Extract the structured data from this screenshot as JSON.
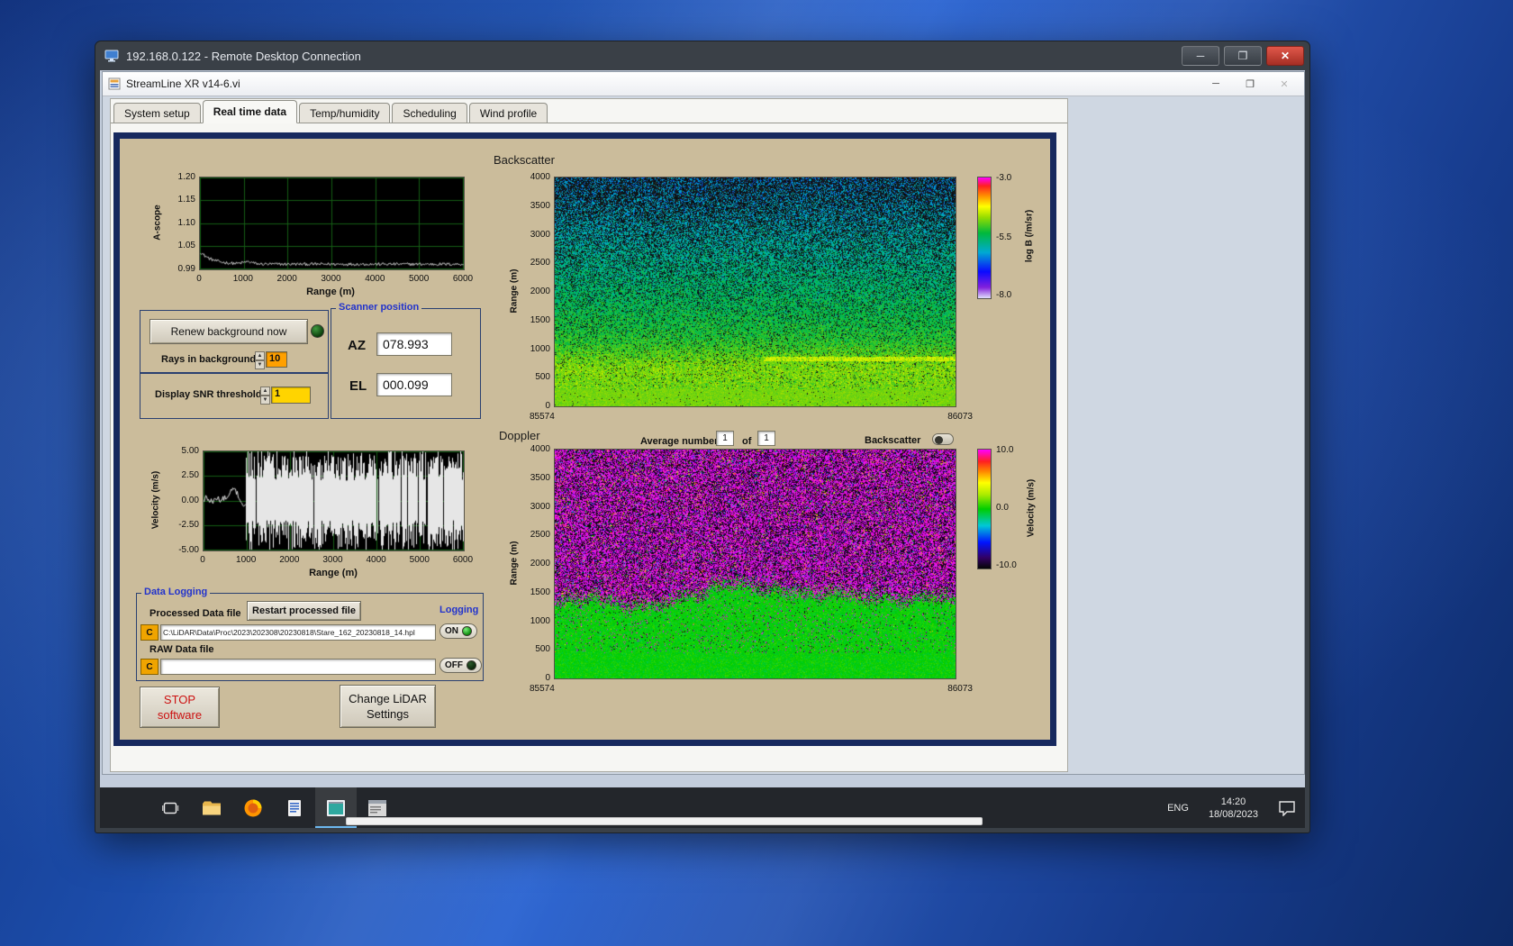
{
  "colors": {
    "panel_tan": "#cbbc9b",
    "panel_border_navy": "#17295e",
    "label_blue": "#2233cc",
    "stop_red": "#cc1111",
    "field_orange": "#ffa000",
    "field_yellow": "#ffd400",
    "led_green": "#2f8f2f",
    "taskbar_accent": "#6cb8f0"
  },
  "window_controls": {
    "minimize": "─",
    "maximize": "❐",
    "close": "✕"
  },
  "rdp": {
    "title": "192.168.0.122 - Remote Desktop Connection"
  },
  "app": {
    "title": "StreamLine XR v14-6.vi",
    "tabs": [
      "System setup",
      "Real time data",
      "Temp/humidity",
      "Scheduling",
      "Wind profile"
    ],
    "active_tab": "Real time data"
  },
  "background_controls": {
    "renew_button": "Renew background now",
    "rays_label": "Rays in background",
    "rays_value": "10",
    "snr_label": "Display SNR threshold",
    "snr_value": "1"
  },
  "scanner": {
    "title": "Scanner position",
    "az_label": "AZ",
    "az_value": "078.993",
    "el_label": "EL",
    "el_value": "000.099"
  },
  "doppler_bar": {
    "avg_label": "Average number",
    "avg_value": "1",
    "of_label": "of",
    "of_count": "1",
    "toggle_label": "Backscatter"
  },
  "logging": {
    "title": "Data Logging",
    "processed_label": "Processed Data file",
    "restart_button": "Restart processed file",
    "logging_label": "Logging",
    "drive": "C",
    "processed_path": "C:\\LiDAR\\Data\\Proc\\2023\\202308\\20230818\\Stare_162_20230818_14.hpl",
    "on_label": "ON",
    "raw_label": "RAW Data file",
    "raw_path": "",
    "off_label": "OFF"
  },
  "action_buttons": {
    "stop_line1": "STOP",
    "stop_line2": "software",
    "change_line1": "Change LiDAR",
    "change_line2": "Settings"
  },
  "taskbar": {
    "lang": "ENG",
    "time": "14:20",
    "date": "18/08/2023",
    "icons": [
      "task-view",
      "file-explorer",
      "firefox",
      "text-editor",
      "remote-viewer-active",
      "scan-schedules"
    ]
  },
  "chart_data": [
    {
      "id": "ascope",
      "type": "line",
      "title": "",
      "xlabel": "Range (m)",
      "ylabel": "A-scope",
      "xlim": [
        0,
        6000
      ],
      "ylim": [
        0.99,
        1.2
      ],
      "xtick_labels": [
        "0",
        "1000",
        "2000",
        "3000",
        "4000",
        "5000",
        "6000"
      ],
      "ytick_labels": [
        "1.20",
        "1.15",
        "1.10",
        "1.05",
        "0.99"
      ],
      "grid": true,
      "bg": "#000000",
      "grid_color": "#155c15",
      "trace_color": "#dcdcdc",
      "series": [
        {
          "name": "a-scope signal",
          "summary": "noisy flat trace near 1.00 with bump to ~1.03 near range 0, decaying by ~800 m"
        }
      ]
    },
    {
      "id": "backscatter",
      "type": "heatmap",
      "title": "Backscatter",
      "ylabel": "Range (m)",
      "xlim": [
        85574,
        86073
      ],
      "ylim": [
        0,
        4000
      ],
      "xtick_labels": [
        "85574",
        "86073"
      ],
      "ytick_labels": [
        "4000",
        "3500",
        "3000",
        "2500",
        "2000",
        "1500",
        "1000",
        "500",
        "0"
      ],
      "colorbar": {
        "label": "log B (/m/sr)",
        "tick_labels": [
          "-3.0",
          "-5.5",
          "-8.0"
        ],
        "vmin": -8.0,
        "vmax": -3.0
      },
      "summary": "strong green backscatter below ~1000 m, teal/blue 1000-2500 m, increasing dark speckle noise above 2500 m, thin brighter aerosol layer near 850 m over the right half"
    },
    {
      "id": "velocity",
      "type": "line",
      "title": "",
      "xlabel": "Range (m)",
      "ylabel": "Velocity (m/s)",
      "xlim": [
        0,
        6000
      ],
      "ylim": [
        -5,
        5
      ],
      "xtick_labels": [
        "0",
        "1000",
        "2000",
        "3000",
        "4000",
        "5000",
        "6000"
      ],
      "ytick_labels": [
        "5.00",
        "2.50",
        "0.00",
        "-2.50",
        "-5.00"
      ],
      "grid": true,
      "bg": "#000000",
      "grid_color": "#155c15",
      "trace_color": "#e6e6e6",
      "series": [
        {
          "name": "radial velocity",
          "summary": "coherent trace near 0 m/s below ~1000 m, saturated random noise spanning ±5 m/s beyond"
        }
      ]
    },
    {
      "id": "doppler",
      "type": "heatmap",
      "title": "Doppler",
      "ylabel": "Range (m)",
      "xlim": [
        85574,
        86073
      ],
      "ylim": [
        0,
        4000
      ],
      "xtick_labels": [
        "85574",
        "86073"
      ],
      "ytick_labels": [
        "4000",
        "3500",
        "3000",
        "2500",
        "2000",
        "1500",
        "1000",
        "500",
        "0"
      ],
      "colorbar": {
        "label": "Velocity (m/s)",
        "tick_labels": [
          "10.0",
          "0.0",
          "-10.0"
        ],
        "vmin": -10.0,
        "vmax": 10.0
      },
      "summary": "coherent ~0 m/s green velocities below ~1100-1500 m, random magenta/black noise above"
    }
  ]
}
